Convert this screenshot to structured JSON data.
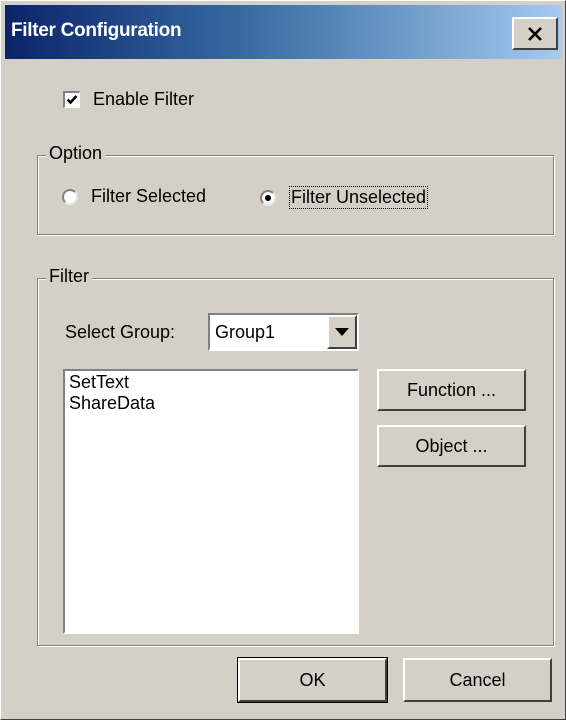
{
  "window": {
    "title": "Filter Configuration",
    "close_glyph": "×"
  },
  "enable_filter": {
    "label": "Enable Filter",
    "checked": true
  },
  "option_group": {
    "title": "Option",
    "radios": [
      {
        "label": "Filter Selected",
        "selected": false
      },
      {
        "label": "Filter Unselected",
        "selected": true
      }
    ]
  },
  "filter_group": {
    "title": "Filter",
    "select_group_label": "Select Group:",
    "select_group_value": "Group1",
    "list_items": [
      "SetText",
      "ShareData"
    ],
    "function_button": "Function ...",
    "object_button": "Object ..."
  },
  "footer": {
    "ok": "OK",
    "cancel": "Cancel"
  },
  "icons": {
    "close": "close-icon",
    "check": "checkmark-icon",
    "dropdown": "triangle-down-icon"
  },
  "colors": {
    "title_start": "#0a246a",
    "title_end": "#a6caf0",
    "face": "#d4d0c8"
  }
}
